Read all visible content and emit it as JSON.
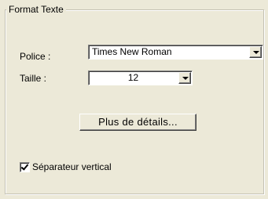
{
  "group": {
    "title": "Format Texte"
  },
  "font": {
    "label": "Police :",
    "value": "Times New Roman"
  },
  "size": {
    "label": "Taille :",
    "value": "12"
  },
  "details_button": {
    "label": "Plus de détails..."
  },
  "separator_checkbox": {
    "label": "Séparateur vertical",
    "checked": true
  }
}
